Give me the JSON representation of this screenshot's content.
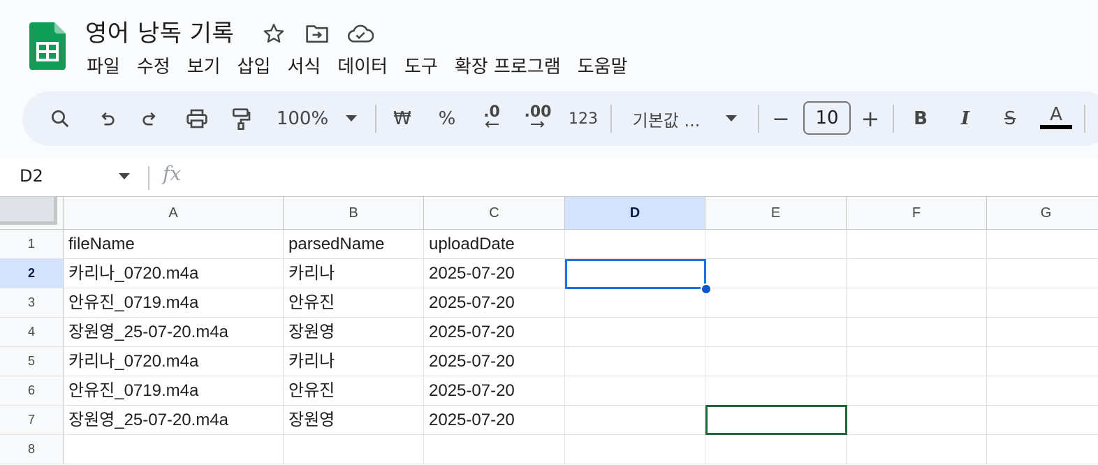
{
  "document": {
    "title": "영어 낭독 기록"
  },
  "menu": [
    "파일",
    "수정",
    "보기",
    "삽입",
    "서식",
    "데이터",
    "도구",
    "확장 프로그램",
    "도움말"
  ],
  "toolbar": {
    "zoom": "100%",
    "currency": "₩",
    "percent": "%",
    "decrease_decimal": ".0",
    "increase_decimal": ".00",
    "number_format": "123",
    "font": "기본값 ...",
    "font_size": "10",
    "minus": "−",
    "plus": "+",
    "bold": "B",
    "italic": "I",
    "strikethrough": "S",
    "text_color": "A"
  },
  "formula_bar": {
    "name_box": "D2",
    "fx": "fx",
    "value": ""
  },
  "columns": [
    "A",
    "B",
    "C",
    "D",
    "E",
    "F",
    "G"
  ],
  "rows": [
    "1",
    "2",
    "3",
    "4",
    "5",
    "6",
    "7",
    "8"
  ],
  "cells": [
    [
      "fileName",
      "parsedName",
      "uploadDate"
    ],
    [
      "카리나_0720.m4a",
      "카리나",
      "2025-07-20"
    ],
    [
      "안유진_0719.m4a",
      "안유진",
      "2025-07-20"
    ],
    [
      "장원영_25-07-20.m4a",
      "장원영",
      "2025-07-20"
    ],
    [
      "카리나_0720.m4a",
      "카리나",
      "2025-07-20"
    ],
    [
      "안유진_0719.m4a",
      "안유진",
      "2025-07-20"
    ],
    [
      "장원영_25-07-20.m4a",
      "장원영",
      "2025-07-20"
    ],
    [
      "",
      "",
      ""
    ]
  ],
  "selected_cell": "D2",
  "selected_column": "D",
  "selected_row": "2",
  "colors": {
    "accent": "#1a73e8",
    "selection_header": "#d3e3fd",
    "sheets_green": "#0f9d58",
    "highlight_border": "#1e6b3a"
  }
}
